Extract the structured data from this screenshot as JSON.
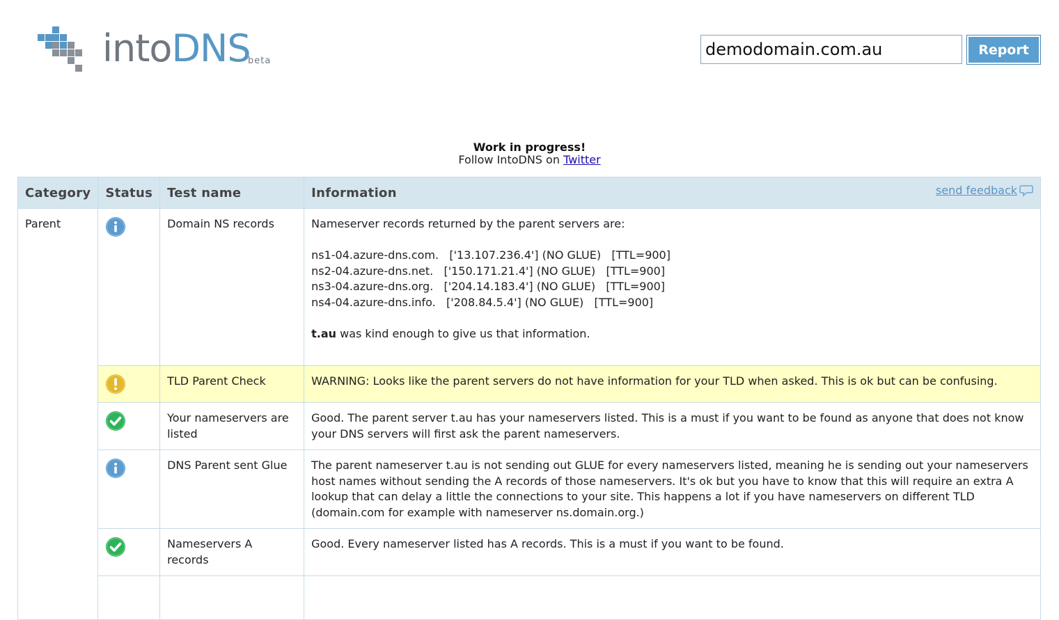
{
  "header": {
    "logo_into": "into",
    "logo_dns": "DNS",
    "logo_beta": "beta",
    "search_value": "demodomain.com.au",
    "report_label": "Report"
  },
  "notice": {
    "title": "Work in progress!",
    "follow_text": "Follow IntoDNS on",
    "twitter_link": "Twitter"
  },
  "table": {
    "headers": {
      "category": "Category",
      "status": "Status",
      "test_name": "Test name",
      "information": "Information",
      "feedback_link": "send feedback"
    },
    "category": "Parent",
    "rows": [
      {
        "status": "info",
        "test_name": "Domain NS records",
        "info_intro": "Nameserver records returned by the parent servers are:",
        "ns_lines": [
          "ns1-04.azure-dns.com.   ['13.107.236.4'] (NO GLUE)   [TTL=900]",
          "ns2-04.azure-dns.net.   ['150.171.21.4'] (NO GLUE)   [TTL=900]",
          "ns3-04.azure-dns.org.   ['204.14.183.4'] (NO GLUE)   [TTL=900]",
          "ns4-04.azure-dns.info.   ['208.84.5.4'] (NO GLUE)   [TTL=900]"
        ],
        "source_bold": "t.au",
        "source_rest": " was kind enough to give us that information."
      },
      {
        "status": "warning",
        "test_name": "TLD Parent Check",
        "info": "WARNING: Looks like the parent servers do not have information for your TLD when asked. This is ok but can be confusing."
      },
      {
        "status": "ok",
        "test_name": "Your nameservers are listed",
        "info": "Good. The parent server t.au has your nameservers listed. This is a must if you want to be found as anyone that does not know your DNS servers will first ask the parent nameservers."
      },
      {
        "status": "info",
        "test_name": "DNS Parent sent Glue",
        "info": "The parent nameserver t.au is not sending out GLUE for every nameservers listed, meaning he is sending out your nameservers host names without sending the A records of those nameservers. It's ok but you have to know that this will require an extra A lookup that can delay a little the connections to your site. This happens a lot if you have nameservers on different TLD (domain.com for example with nameserver ns.domain.org.)"
      },
      {
        "status": "ok",
        "test_name": "Nameservers A records",
        "info": "Good. Every nameserver listed has A records. This is a must if you want to be found."
      }
    ]
  },
  "colors": {
    "logo_blue": "#5797c4",
    "logo_gray": "#707780",
    "header_bg": "#d6e6ef",
    "warning_bg": "#ffffc6",
    "info_icon": "#5b9bd0",
    "warning_icon": "#e3b82c",
    "ok_icon": "#2fb35a"
  }
}
